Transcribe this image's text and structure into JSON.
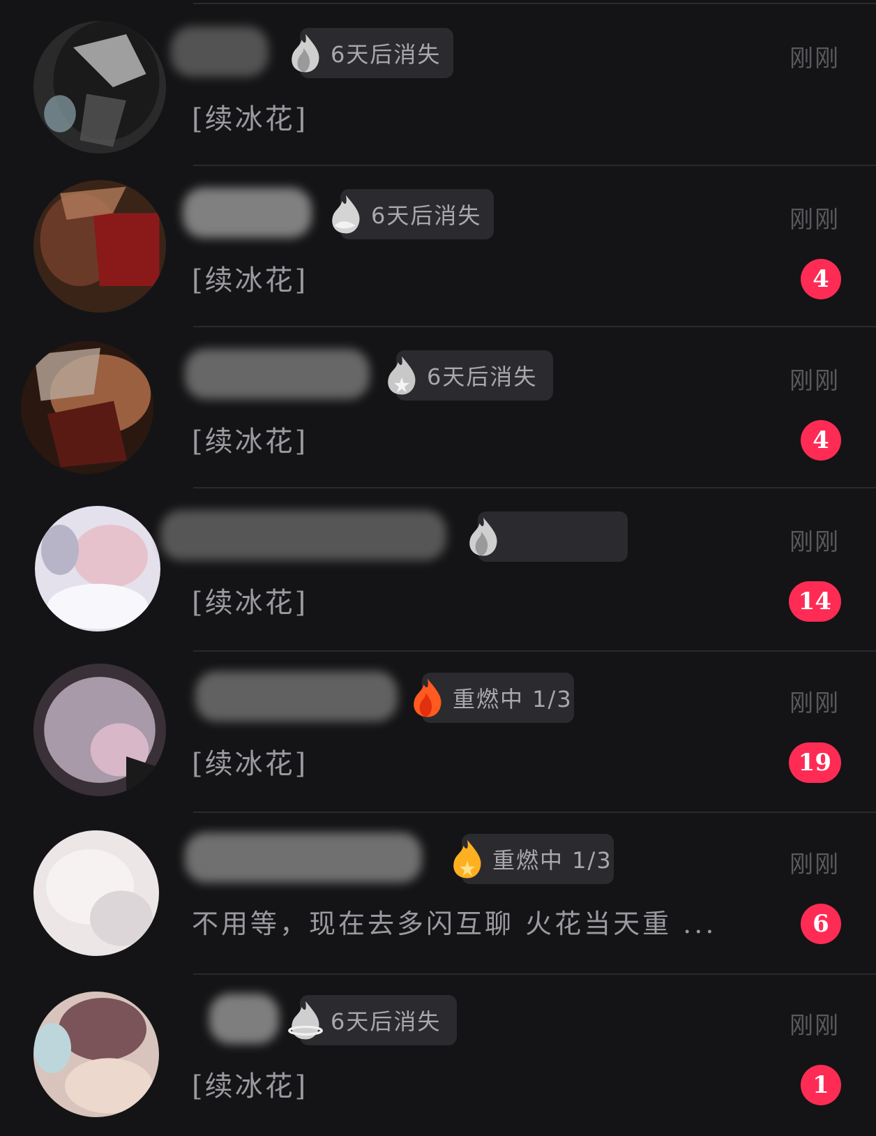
{
  "colors": {
    "background": "#141416",
    "divider": "#2a2a2e",
    "unread_badge": "#fe2c55",
    "badge_bg": "#2b2b2f",
    "flame_grey": "#d9d9d9",
    "flame_orange": "#ff5a1f",
    "flame_gold": "#ffb020"
  },
  "conversations": [
    {
      "spark_icon": "grey-flame-icon",
      "spark_status": "6天后消失",
      "last_message": "[续冰花]",
      "time": "刚刚",
      "unread": ""
    },
    {
      "spark_icon": "grey-leaf-flame-icon",
      "spark_status": "6天后消失",
      "last_message": "[续冰花]",
      "time": "刚刚",
      "unread": "4"
    },
    {
      "spark_icon": "grey-star-flame-icon",
      "spark_status": "6天后消失",
      "last_message": "[续冰花]",
      "time": "刚刚",
      "unread": "4"
    },
    {
      "spark_icon": "grey-flame-icon",
      "spark_status": "",
      "last_message": "[续冰花]",
      "time": "刚刚",
      "unread": "14"
    },
    {
      "spark_icon": "orange-flame-icon",
      "spark_status": "重燃中 1/3",
      "last_message": "[续冰花]",
      "time": "刚刚",
      "unread": "19"
    },
    {
      "spark_icon": "gold-star-flame-icon",
      "spark_status": "重燃中 1/3",
      "last_message": "不用等，现在去多闪互聊 火花当天重 ...",
      "time": "刚刚",
      "unread": "6"
    },
    {
      "spark_icon": "grey-planet-flame-icon",
      "spark_status": "6天后消失",
      "last_message": "[续冰花]",
      "time": "刚刚",
      "unread": "1"
    }
  ]
}
